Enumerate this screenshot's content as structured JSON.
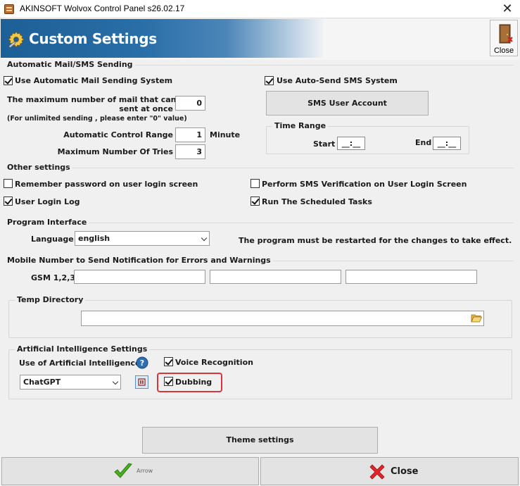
{
  "window": {
    "title": "AKINSOFT Wolvox Control Panel s26.02.17",
    "close_glyph": "✕"
  },
  "header": {
    "title": "Custom Settings",
    "close_label": "Close"
  },
  "mail_sms": {
    "title": "Automatic Mail/SMS Sending",
    "use_mail_label": "Use Automatic Mail Sending System",
    "use_mail_checked": true,
    "max_mail_label_1": "The maximum number of mail that can be",
    "max_mail_label_2": "sent at once",
    "max_mail_value": "0",
    "unlimited_note": "(For unlimited sending , please enter \"0\" value)",
    "control_range_label": "Automatic Control Range",
    "control_range_value": "1",
    "minute_label": "Minute",
    "max_tries_label": "Maximum Number Of Tries",
    "max_tries_value": "3",
    "use_sms_label": "Use Auto-Send SMS System",
    "use_sms_checked": true,
    "sms_account_button": "SMS User Account",
    "time_range_title": "Time Range",
    "start_label": "Start",
    "start_value": "__:__",
    "end_label": "End",
    "end_value": "__:__"
  },
  "other": {
    "title": "Other settings",
    "remember_password_label": "Remember password on user login screen",
    "remember_password_checked": false,
    "sms_verification_label": "Perform SMS Verification on User Login Screen",
    "sms_verification_checked": false,
    "user_login_log_label": "User Login Log",
    "user_login_log_checked": true,
    "scheduled_tasks_label": "Run The Scheduled Tasks",
    "scheduled_tasks_checked": true
  },
  "interface": {
    "title": "Program Interface",
    "language_label": "Language",
    "language_value": "english",
    "restart_note": "The program must be restarted for the changes to take effect."
  },
  "mobile": {
    "title": "Mobile Number to Send Notification for Errors and Warnings",
    "gsm_label": "GSM 1,2,3",
    "gsm_values": [
      "",
      "",
      ""
    ]
  },
  "temp": {
    "title": "Temp Directory",
    "path": ""
  },
  "ai": {
    "title": "Artificial Intelligence Settings",
    "use_ai_label": "Use of Artificial Intelligence",
    "provider_value": "ChatGPT",
    "voice_recognition_label": "Voice Recognition",
    "voice_recognition_checked": true,
    "dubbing_label": "Dubbing",
    "dubbing_checked": true,
    "highlight_color": "#d9343a"
  },
  "buttons": {
    "theme_settings": "Theme settings",
    "arrow": "Arrow",
    "close": "Close"
  },
  "colors": {
    "header_blue": "#1d5f97",
    "check_green": "#4caf1f",
    "close_red": "#e0262b"
  }
}
